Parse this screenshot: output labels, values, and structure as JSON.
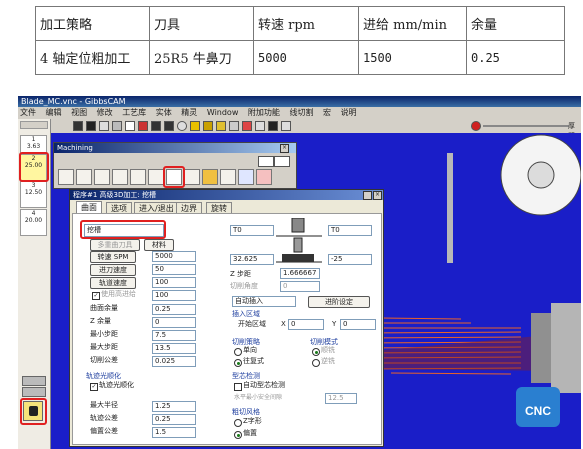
{
  "table": {
    "headers": [
      "加工策略",
      "刀具",
      "转速 rpm",
      "进给 mm/min",
      "余量"
    ],
    "row": [
      "4 轴定位粗加工",
      "25R5 牛鼻刀",
      "5000",
      "1500",
      "0.25"
    ]
  },
  "app": {
    "title": "Blade_MC.vnc - GibbsCAM",
    "menu": [
      "文件",
      "编辑",
      "视图",
      "修改",
      "工艺库",
      "实体",
      "精灵",
      "Window",
      "附加功能",
      "线切割",
      "宏",
      "说明"
    ],
    "toolbar_right": "厚壁",
    "left_slots": [
      "1",
      "2",
      "3",
      "4"
    ],
    "left_slot_subs": [
      "3.63",
      "25.00",
      "12.50",
      "20.00"
    ]
  },
  "machining": {
    "title": "Machining"
  },
  "dialog": {
    "title": "程序#1 高级3D加工: 挖槽",
    "tabs": [
      "曲面",
      "选项",
      "进入/退出",
      "边界",
      "旋转"
    ],
    "strategy": "挖槽",
    "left": {
      "multi_layer_btn": "多重曲刀具",
      "material_btn": "材料",
      "speed_btn": "转速 SPM",
      "speed": "5000",
      "feed_btn": "进刀速度",
      "feed": "50",
      "plunge_btn": "轨道速度",
      "plunge": "100",
      "rapid_label": "使用高进给",
      "rapid": "100",
      "surface_stock_label": "曲面余量",
      "surface_stock": "0.25",
      "z_stock_label": "Z 余量",
      "z_stock": "0",
      "min_step_label": "最小步距",
      "min_step": "7.5",
      "max_step_label": "最大步距",
      "max_step": "13.5",
      "cut_tol_label": "切削公差",
      "cut_tol": "0.025"
    },
    "smooth": {
      "group": "轨迹光顺化",
      "check_label": "轨迹光顺化",
      "max_radius_label": "最大半径",
      "max_radius": "1.25",
      "path_tol_label": "轨迹公差",
      "path_tol": "0.25",
      "offset_tol_label": "偏置公差",
      "offset_tol": "1.5"
    },
    "right": {
      "top1": "T0",
      "top2": "T0",
      "val_left": "32.625",
      "val_right": "-25",
      "z_step_label": "Z 步距",
      "z_step": "1.666667",
      "cut_angle_label": "切削角度",
      "cut_angle": "0",
      "auto_insert": "自动插入",
      "advanced_btn": "进阶设定",
      "entry_group": "插入区域",
      "start_area_label": "开始区域",
      "x_label": "X",
      "x_val": "0",
      "y_label": "Y",
      "y_val": "0",
      "cut_dir_group": "切削策略",
      "cut_mode_group": "切削模式",
      "one_way": "单向",
      "zigzag": "往复式",
      "climb": "顺铣",
      "conventional": "逆铣",
      "core_group": "型芯检测",
      "auto_core": "自动型芯检测",
      "safety_label": "水平最小安全间隙",
      "safety_val": "12.5",
      "rough_group": "粗切风格",
      "z_shape": "Z字形",
      "offset": "偏置"
    }
  },
  "logo": "CNC",
  "colors": {
    "viewport": "#1a1ec8",
    "highlight": "#e02020",
    "toolpath": "#ff6a1a"
  }
}
